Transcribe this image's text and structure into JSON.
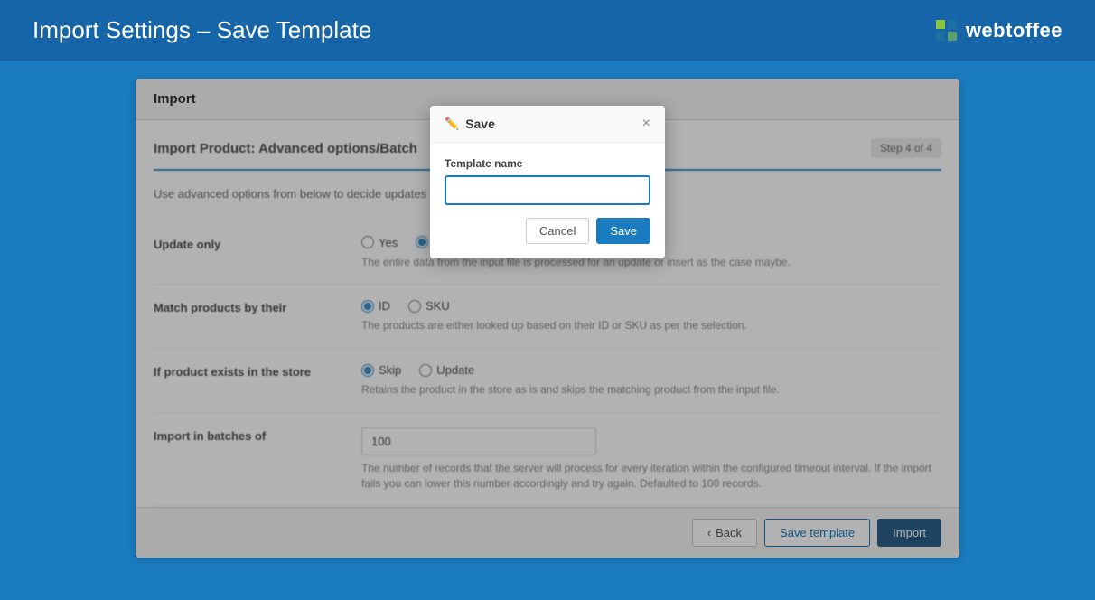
{
  "header": {
    "title": "Import Settings – Save Template",
    "logo_text": "webtoffee"
  },
  "import_panel": {
    "panel_title": "Import",
    "step_title": "Import Product: Advanced options/Batch",
    "step_badge": "Step 4 of 4",
    "description": "Use advanced options from below to decide updates to save the template file for future imports.",
    "options": [
      {
        "label": "Update only",
        "type": "radio",
        "choices": [
          "Yes",
          "No"
        ],
        "selected": "No",
        "hint": "The entire data from the input file is processed for an update or insert as the case maybe."
      },
      {
        "label": "Match products by their",
        "type": "radio",
        "choices": [
          "ID",
          "SKU"
        ],
        "selected": "ID",
        "hint": "The products are either looked up based on their ID or SKU as per the selection."
      },
      {
        "label": "If product exists in the store",
        "type": "radio",
        "choices": [
          "Skip",
          "Update"
        ],
        "selected": "Skip",
        "hint": "Retains the product in the store as is and skips the matching product from the input file."
      },
      {
        "label": "Import in batches of",
        "type": "input",
        "value": "100",
        "hint": "The number of records that the server will process for every iteration within the configured timeout interval. If the import fails you can lower this number accordingly and try again. Defaulted to 100 records."
      }
    ],
    "actions": {
      "back_label": "Back",
      "save_template_label": "Save template",
      "import_label": "Import"
    }
  },
  "modal": {
    "title": "Save",
    "close_label": "×",
    "field_label": "Template name",
    "field_placeholder": "",
    "cancel_label": "Cancel",
    "save_label": "Save"
  }
}
